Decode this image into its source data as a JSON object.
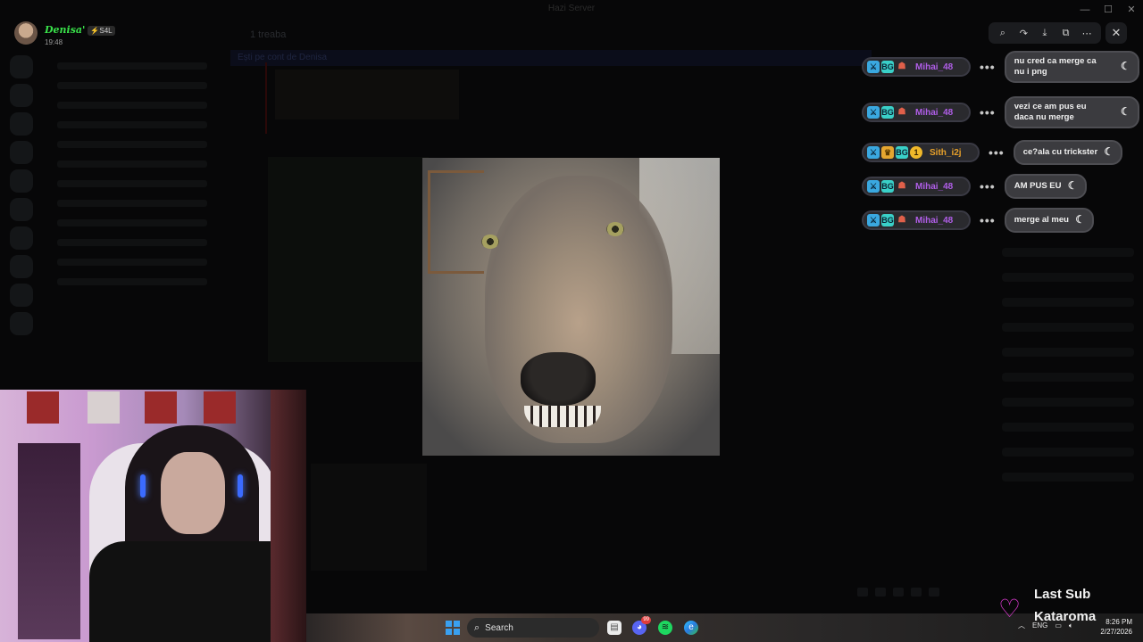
{
  "window": {
    "title": "Hazi Server"
  },
  "background": {
    "channel_title": "1 treaba",
    "banner_text": "Ești pe cont de Denisa"
  },
  "user": {
    "name": "Denisa'",
    "tag": "⚡S4L",
    "time": "19:48"
  },
  "viewer_toolbar": {
    "icons": [
      "zoom-icon",
      "forward-icon",
      "download-icon",
      "open-external-icon",
      "more-icon"
    ],
    "close_icon": "close-icon"
  },
  "chat": [
    {
      "user": "Mihai_48",
      "color": "#b05ee8",
      "badges": [
        "sword",
        "BG",
        "5yr"
      ],
      "lines": [
        "nu cred ca merge ca",
        "nu i png"
      ]
    },
    {
      "user": "Mihai_48",
      "color": "#b05ee8",
      "badges": [
        "sword",
        "BG",
        "5yr"
      ],
      "lines": [
        "vezi ce am pus eu",
        "daca nu merge"
      ]
    },
    {
      "user": "Sith_i2j",
      "color": "#e8a12a",
      "badges": [
        "sword",
        "crown",
        "BG",
        "1"
      ],
      "lines": [
        "ce?ala cu trickster"
      ]
    },
    {
      "user": "Mihai_48",
      "color": "#b05ee8",
      "badges": [
        "sword",
        "BG",
        "5yr"
      ],
      "lines": [
        "AM PUS EU"
      ]
    },
    {
      "user": "Mihai_48",
      "color": "#b05ee8",
      "badges": [
        "sword",
        "BG",
        "5yr"
      ],
      "lines": [
        "merge al meu"
      ]
    }
  ],
  "last_sub": {
    "title": "Last Sub",
    "name": "Kataroma",
    "heart_color": "#e23bd6"
  },
  "taskbar": {
    "search_placeholder": "Search",
    "discord_badge": "99",
    "language": "ENG",
    "time": "8:26 PM",
    "date": "2/27/2026"
  }
}
